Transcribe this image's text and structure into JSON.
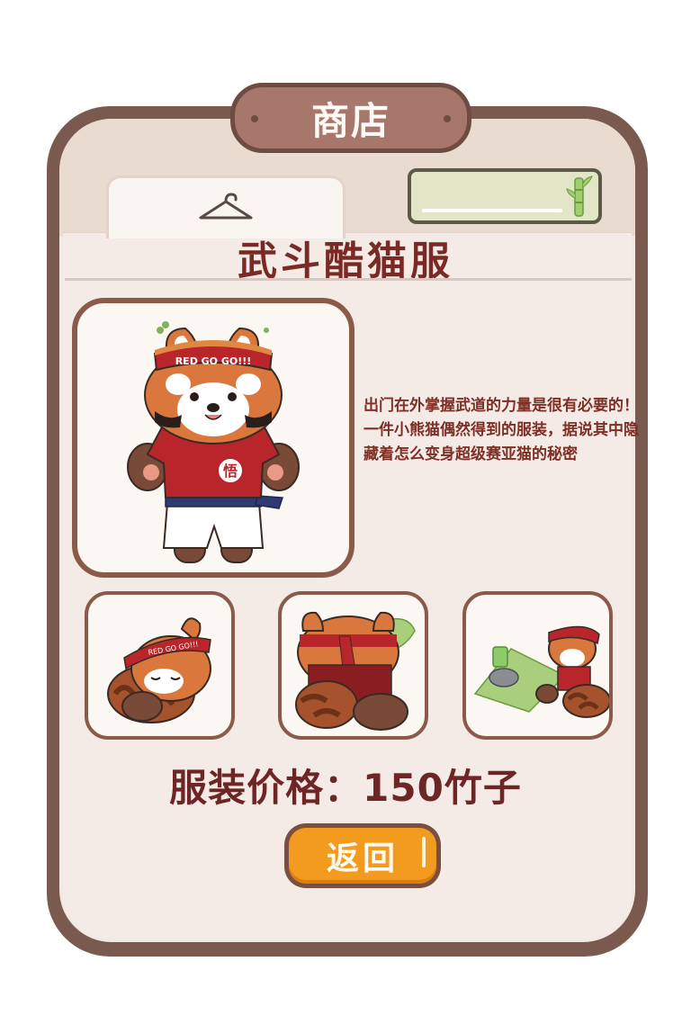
{
  "header": {
    "title": "商店"
  },
  "tab": {
    "icon": "hanger-icon"
  },
  "currency": {
    "value": "",
    "icon": "bamboo-icon"
  },
  "item": {
    "name": "武斗酷猫服",
    "headband_text": "RED GO GO!!!",
    "shirt_emblem": "悟",
    "description": "出门在外掌握武道的力量是很有必要的！一件小熊猫偶然得到的服装，据说其中隐藏着怎么变身超级赛亚猫的秘密"
  },
  "price": {
    "text": "服装价格：150竹子"
  },
  "buttons": {
    "back_label": "返回"
  },
  "colors": {
    "frame_brown": "#7a5a4e",
    "title_red": "#7a2a24",
    "button_orange": "#f29b1e",
    "panda_orange": "#d9773c",
    "shirt_red": "#b8262b"
  }
}
